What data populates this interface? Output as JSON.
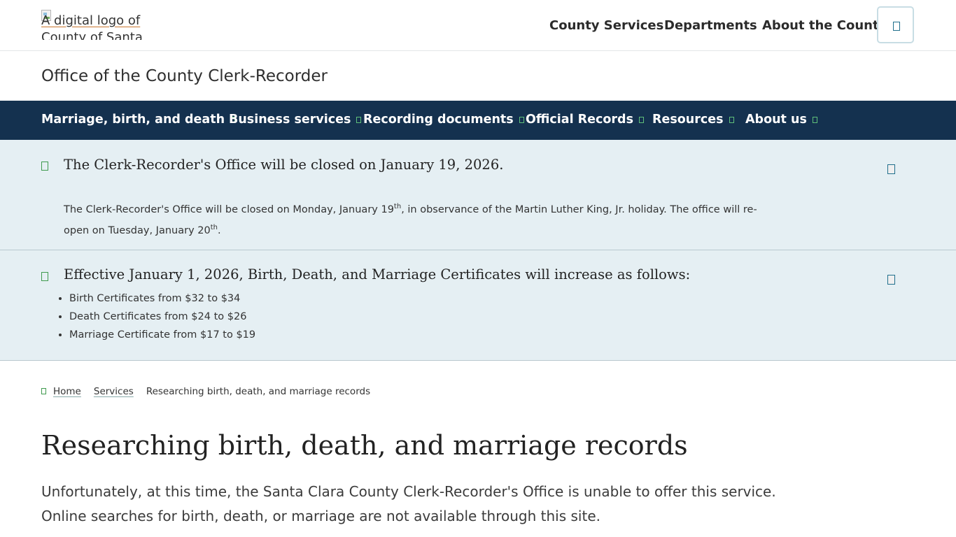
{
  "header": {
    "logo_alt": "A digital logo of County of Santa Clara",
    "nav": [
      "County Services",
      "Departments",
      "About the County"
    ]
  },
  "office_title": "Office of the County Clerk-Recorder",
  "main_nav": [
    "Marriage, birth, and death",
    "Business services",
    "Recording documents",
    "Official Records",
    "Resources",
    "About us"
  ],
  "alerts": [
    {
      "title": "The Clerk-Recorder's Office will be closed on January 19, 2026.",
      "body_part1": "The Clerk-Recorder's Office will be closed on Monday, January 19",
      "sup1": "th",
      "body_part2": ", in observance of the Martin Luther King, Jr. holiday.  The office will re-open on Tuesday, January 20",
      "sup2": "th",
      "body_part3": "."
    },
    {
      "title": "Effective January 1, 2026, Birth, Death, and Marriage Certificates will increase as follows:",
      "items": [
        "Birth Certificates from $32 to $34",
        "Death Certificates from $24 to $26",
        "Marriage Certificate from $17 to $19"
      ]
    }
  ],
  "breadcrumb": {
    "home": "Home",
    "services": "Services",
    "current": "Researching birth, death, and marriage records"
  },
  "page": {
    "title": "Researching birth, death, and marriage records",
    "intro": "Unfortunately, at this time, the Santa Clara County Clerk-Recorder's Office is unable to offer this service. Online searches for birth, death, or marriage are not available through this site."
  },
  "colors": {
    "nav_bg": "#14314f",
    "alert_bg": "#e5eff3",
    "accent_green": "#3f9a4e",
    "accent_teal": "#1f6f8c"
  }
}
